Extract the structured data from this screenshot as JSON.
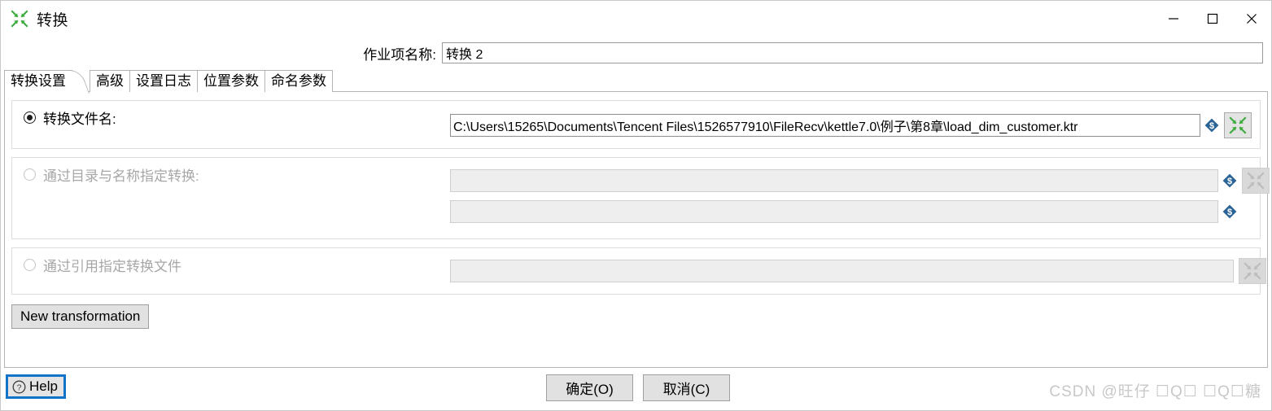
{
  "window": {
    "title": "转换",
    "icon": "transformation-icon",
    "controls": {
      "minimize": "minimize-icon",
      "maximize": "maximize-icon",
      "close": "close-icon"
    }
  },
  "job_name": {
    "label": "作业项名称:",
    "value": "转换 2",
    "placeholder": ""
  },
  "tabs": [
    {
      "label": "转换设置",
      "selected": true
    },
    {
      "label": "高级",
      "selected": false
    },
    {
      "label": "设置日志",
      "selected": false
    },
    {
      "label": "位置参数",
      "selected": false
    },
    {
      "label": "命名参数",
      "selected": false
    }
  ],
  "options": {
    "by_filename": {
      "label": "转换文件名:",
      "selected": true,
      "enabled": true,
      "value": "C:\\Users\\15265\\Documents\\Tencent Files\\1526577910\\FileRecv\\kettle7.0\\例子\\第8章\\load_dim_customer.ktr",
      "variable_icon": "variable-diamond-icon",
      "browse_icon": "transformation-icon"
    },
    "by_directory_and_name": {
      "label": "通过目录与名称指定转换:",
      "selected": false,
      "enabled": false,
      "directory_value": "",
      "name_value": "",
      "variable_icon": "variable-diamond-icon",
      "browse_icon": "transformation-icon"
    },
    "by_reference": {
      "label": "通过引用指定转换文件",
      "selected": false,
      "enabled": false,
      "value": "",
      "browse_icon": "transformation-icon"
    }
  },
  "new_transformation_button": "New transformation",
  "footer": {
    "help_label": "Help",
    "help_icon": "question-circle-icon",
    "ok_label": "确定(O)",
    "cancel_label": "取消(C)",
    "watermark": "CSDN @旺仔 ☐Q☐ ☐Q☐糖"
  },
  "colors": {
    "accent_focus": "#1274c8",
    "icon_green": "#3daa3d",
    "icon_blue": "#2a6496",
    "disabled_text": "#a7a7a7",
    "watermark": "#c8c8c8"
  }
}
